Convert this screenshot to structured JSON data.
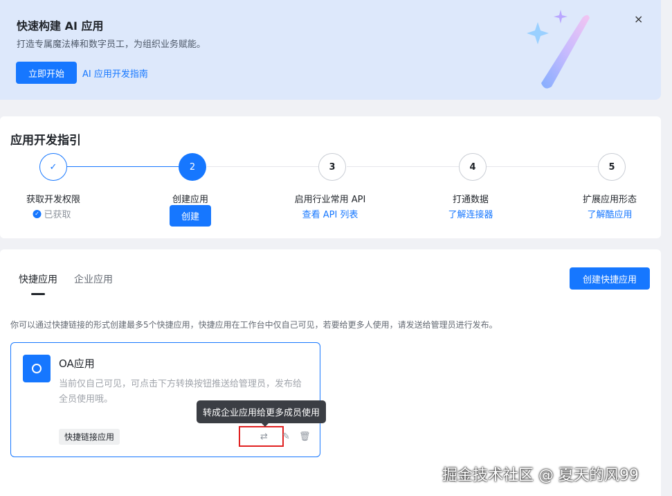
{
  "banner": {
    "title": "快速构建 AI 应用",
    "subtitle": "打造专属魔法棒和数字员工，为组织业务赋能。",
    "start_button": "立即开始",
    "guide_link": "AI 应用开发指南",
    "close_glyph": "×"
  },
  "guide": {
    "title": "应用开发指引",
    "steps": [
      {
        "number": "✓",
        "label": "获取开发权限",
        "sub": "已获取"
      },
      {
        "number": "2",
        "label": "创建应用",
        "button": "创建"
      },
      {
        "number": "3",
        "label": "启用行业常用 API",
        "sub": "查看 API 列表"
      },
      {
        "number": "4",
        "label": "打通数据",
        "sub": "了解连接器"
      },
      {
        "number": "5",
        "label": "扩展应用形态",
        "sub": "了解酷应用"
      }
    ]
  },
  "apps": {
    "tabs": [
      "快捷应用",
      "企业应用"
    ],
    "create_button": "创建快捷应用",
    "notice": "你可以通过快捷链接的形式创建最多5个快捷应用，快捷应用在工作台中仅自己可见，若要给更多人使用，请发送给管理员进行发布。",
    "card": {
      "name": "OA应用",
      "description": "当前仅自己可见，可点击下方转换按钮推送给管理员，发布给全员使用哦。",
      "tag": "快捷链接应用",
      "convert_glyph": "⇄",
      "edit_glyph": "✎",
      "delete_glyph": "🗑"
    },
    "tooltip": "转成企业应用给更多成员使用"
  },
  "watermark": "掘金技术社区 @ 夏天的风99",
  "colors": {
    "primary": "#1677ff",
    "banner_bg": "#dde8fb",
    "page_bg": "#f0f1f5",
    "highlight_box": "#e02020"
  }
}
